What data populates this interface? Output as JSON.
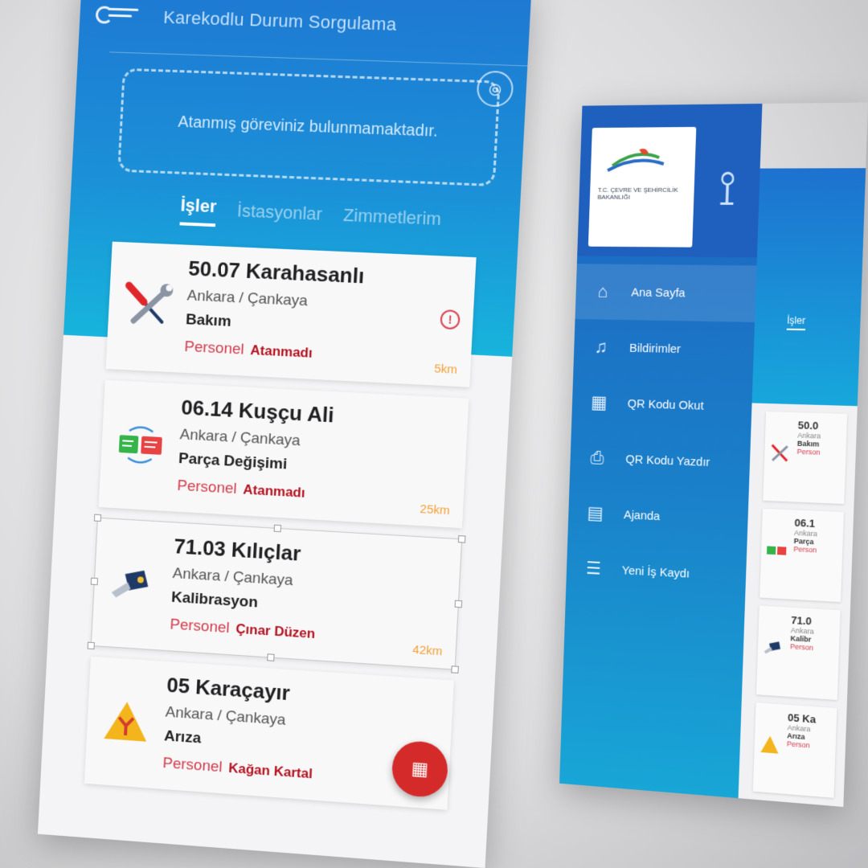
{
  "left_screen": {
    "title": "Karekodlu Durum Sorgulama",
    "empty_message": "Atanmış göreviniz bulunmamaktadır.",
    "tabs": [
      {
        "label": "İşler",
        "active": true
      },
      {
        "label": "İstasyonlar",
        "active": false
      },
      {
        "label": "Zimmetlerim",
        "active": false
      }
    ],
    "cards": [
      {
        "title": "50.07 Karahasanlı",
        "location": "Ankara / Çankaya",
        "type": "Bakım",
        "person_label": "Personel",
        "person": "Atanmadı",
        "distance": "5km",
        "icon": "wrench-screwdriver-icon",
        "alert": "!"
      },
      {
        "title": "06.14 Kuşçu Ali",
        "location": "Ankara / Çankaya",
        "type": "Parça Değişimi",
        "person_label": "Personel",
        "person": "Atanmadı",
        "distance": "25km",
        "icon": "swap-parts-icon"
      },
      {
        "title": "71.03 Kılıçlar",
        "location": "Ankara / Çankaya",
        "type": "Kalibrasyon",
        "person_label": "Personel",
        "person": "Çınar Düzen",
        "distance": "42km",
        "icon": "drill-icon"
      },
      {
        "title": "05 Karaçayır",
        "location": "Ankara / Çankaya",
        "type": "Arıza",
        "person_label": "Personel",
        "person": "Kağan Kartal",
        "distance": "",
        "icon": "warning-icon"
      }
    ],
    "fab_icon": "qr-scan-icon"
  },
  "right_screen": {
    "logo_text": "T.C. ÇEVRE VE ŞEHİRCİLİK BAKANLIĞI",
    "menu": [
      {
        "label": "Ana Sayfa",
        "icon": "home-icon",
        "active": true
      },
      {
        "label": "Bildirimler",
        "icon": "bell-icon",
        "active": false
      },
      {
        "label": "QR Kodu Okut",
        "icon": "qr-read-icon",
        "active": false
      },
      {
        "label": "QR Kodu Yazdır",
        "icon": "printer-icon",
        "active": false
      },
      {
        "label": "Ajanda",
        "icon": "calendar-icon",
        "active": false
      },
      {
        "label": "Yeni İş Kaydı",
        "icon": "new-task-icon",
        "active": false
      }
    ],
    "behind_tab": "İşler",
    "behind_cards": [
      {
        "title": "50.0",
        "sub": "Ankara",
        "type": "Bakım",
        "person": "Person"
      },
      {
        "title": "06.1",
        "sub": "Ankara",
        "type": "Parça",
        "person": "Person"
      },
      {
        "title": "71.0",
        "sub": "Ankara",
        "type": "Kalibr",
        "person": "Person"
      },
      {
        "title": "05 Ka",
        "sub": "Ankara",
        "type": "Arıza",
        "person": "Person"
      }
    ]
  },
  "colors": {
    "accent_blue": "#1b90d8",
    "alert_red": "#b3121f",
    "distance_orange": "#f2a035",
    "fab_red": "#d42a2a"
  }
}
